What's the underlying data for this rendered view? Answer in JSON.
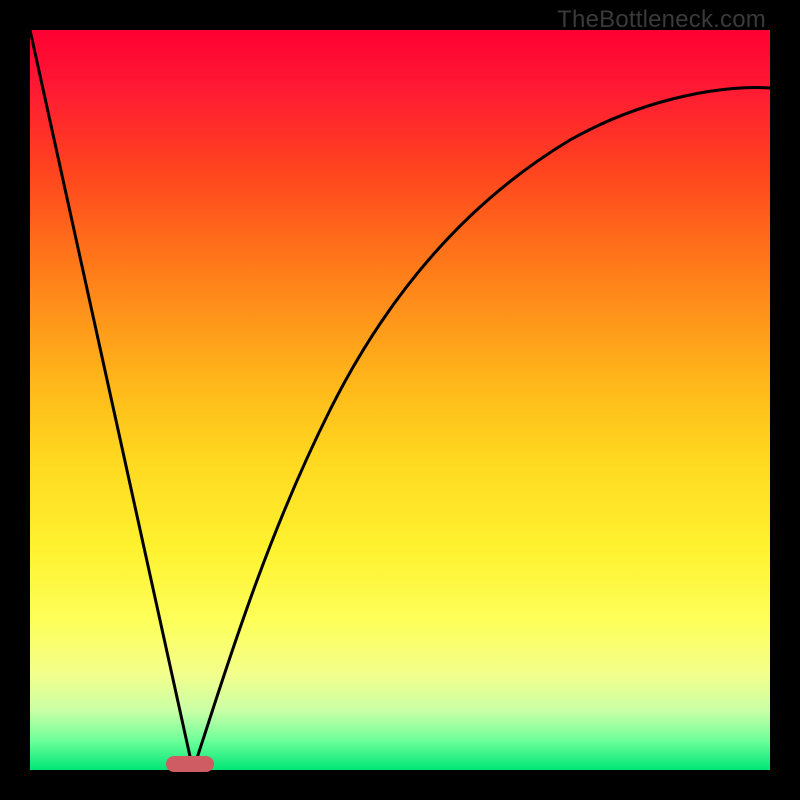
{
  "watermark": "TheBottleneck.com",
  "chart_data": {
    "type": "line",
    "title": "",
    "xlabel": "",
    "ylabel": "",
    "xlim": [
      0,
      100
    ],
    "ylim": [
      0,
      100
    ],
    "grid": false,
    "legend": false,
    "series": [
      {
        "name": "left-branch",
        "x": [
          0,
          5,
          10,
          15,
          20,
          22
        ],
        "y": [
          100,
          77,
          55,
          32,
          9,
          0
        ]
      },
      {
        "name": "right-branch",
        "x": [
          22,
          25,
          30,
          35,
          40,
          45,
          50,
          55,
          60,
          65,
          70,
          75,
          80,
          85,
          90,
          95,
          100
        ],
        "y": [
          0,
          10,
          24,
          36,
          47,
          56,
          63,
          69,
          74,
          78,
          82,
          85,
          87,
          89,
          90.5,
          91.5,
          92
        ]
      }
    ],
    "marker": {
      "name": "bottleneck-point",
      "x": 22,
      "y": 0,
      "color": "#cf5b63"
    },
    "background_gradient": {
      "top": "#ff0033",
      "mid": "#ffd81f",
      "bottom": "#00e676"
    }
  }
}
